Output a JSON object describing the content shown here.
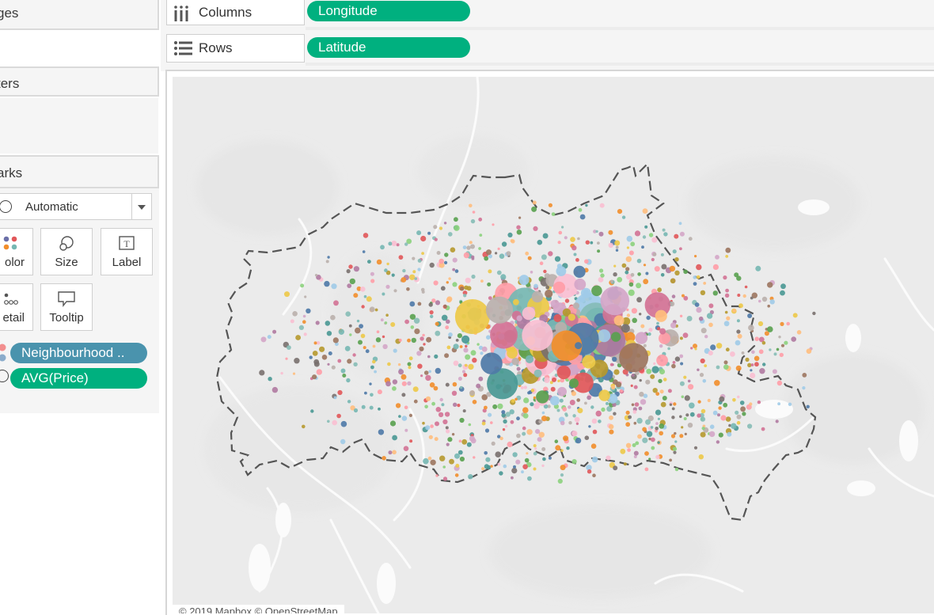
{
  "cards": {
    "pages_title": "ges",
    "filters_title": "ters",
    "marks_title": "arks"
  },
  "marks": {
    "mark_type": "Automatic",
    "buttons": {
      "color": "olor",
      "size": "Size",
      "label": "Label",
      "detail": "etail",
      "tooltip": "Tooltip"
    },
    "pills": {
      "color_field": "Neighbourhood ..",
      "size_field": "AVG(Price)"
    }
  },
  "shelves": {
    "columns_label": "Columns",
    "columns_field": "Longitude",
    "rows_label": "Rows",
    "rows_field": "Latitude"
  },
  "map": {
    "attribution": "© 2019 Mapbox © OpenStreetMap"
  },
  "colors": {
    "measure_pill": "#00b07f",
    "dimension_pill": "#4a93ad",
    "palette": [
      "#4e79a7",
      "#f28e2b",
      "#e15759",
      "#76b7b2",
      "#59a14f",
      "#edc948",
      "#b07aa1",
      "#ff9da7",
      "#9c755f",
      "#bab0ac",
      "#a0cbe8",
      "#ffbe7d",
      "#8cd17d",
      "#b6992d",
      "#499894",
      "#d37295",
      "#fabfd2",
      "#79706e",
      "#d4a6c8",
      "#86bcb6"
    ]
  }
}
